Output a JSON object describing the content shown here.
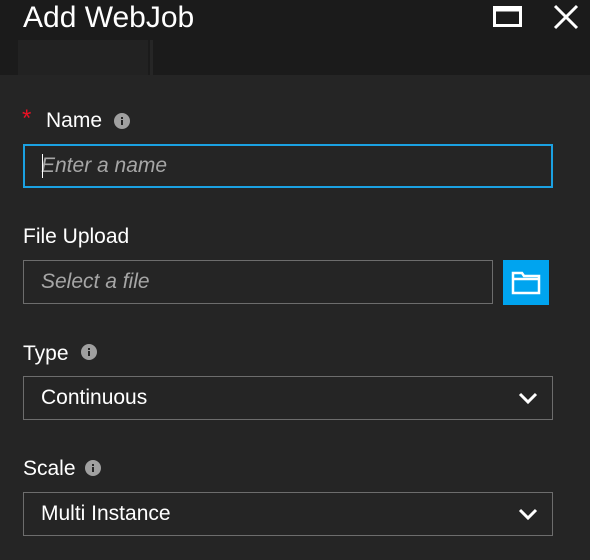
{
  "header": {
    "title": "Add WebJob",
    "maximize_icon": "maximize-icon",
    "close_icon": "close-icon"
  },
  "form": {
    "name": {
      "required_marker": "*",
      "label": "Name",
      "placeholder": "Enter a name",
      "value": ""
    },
    "file_upload": {
      "label": "File Upload",
      "placeholder": "Select a file",
      "button_icon": "folder-icon"
    },
    "type": {
      "label": "Type",
      "selected": "Continuous"
    },
    "scale": {
      "label": "Scale",
      "selected": "Multi Instance"
    }
  },
  "colors": {
    "accent": "#1ba1e2",
    "required": "#e81123",
    "background": "#252525",
    "header_background": "#1b1b1b"
  }
}
